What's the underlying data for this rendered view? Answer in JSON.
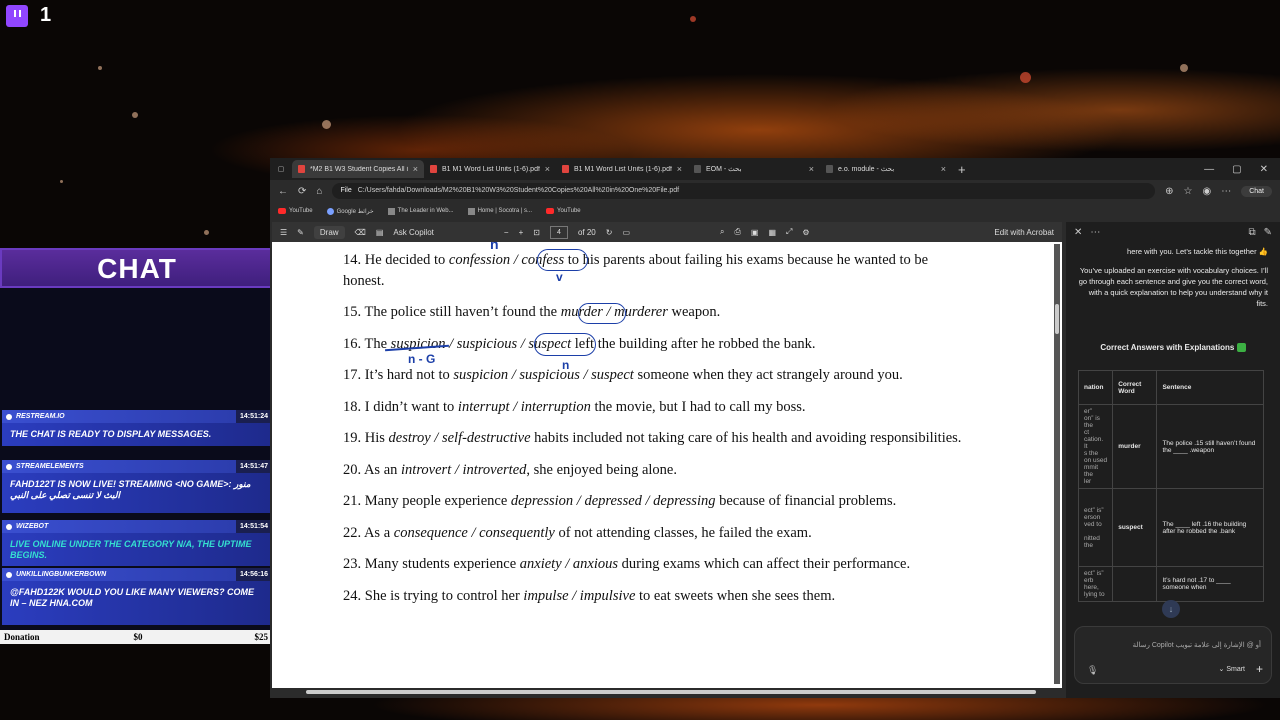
{
  "stream": {
    "viewer_count": "1"
  },
  "chat": {
    "title": "CHAT",
    "messages": [
      {
        "user": "RESTREAM.IO",
        "time": "14:51:24",
        "text": "THE CHAT IS READY TO DISPLAY MESSAGES.",
        "teal": false
      },
      {
        "user": "STREAMELEMENTS",
        "time": "14:51:47",
        "text": "FAHD122T IS NOW LIVE! STREAMING <NO GAME>: منور البث لا تنسى تصلي على النبي",
        "teal": false
      },
      {
        "user": "WIZEBOT",
        "time": "14:51:54",
        "text": "LIVE ONLINE UNDER THE CATEGORY N/A, THE UPTIME BEGINS.",
        "teal": true
      },
      {
        "user": "UNKILLINGBUNKERBOWN",
        "time": "14:56:16",
        "text": "@FAHD122K WOULD YOU LIKE MANY VIEWERS? COME IN – NEZ HNA.COM",
        "teal": false
      }
    ],
    "donation": {
      "label": "Donation",
      "current": "$0",
      "goal": "$25"
    }
  },
  "browser": {
    "tabs": [
      {
        "label": "*M2 B1 W3 Student Copies All in",
        "active": true
      },
      {
        "label": "B1 M1 Word List Units (1-6).pdf",
        "active": false
      },
      {
        "label": "B1 M1 Word List Units (1-6).pdf",
        "active": false
      },
      {
        "label": "EOM - بحث",
        "active": false
      },
      {
        "label": "e.o. module - بحث",
        "active": false
      }
    ],
    "address": {
      "scheme": "File",
      "url": "C:/Users/fahda/Downloads/M2%20B1%20W3%20Student%20Copies%20All%20in%20One%20File.pdf"
    },
    "copilot_chip": "Chat",
    "bookmarks": [
      "YouTube",
      "Google خرائط",
      "The Leader in Web...",
      "Home | Socotra | s...",
      "YouTube"
    ]
  },
  "pdf_toolbar": {
    "draw": "Draw",
    "ask_copilot": "Ask Copilot",
    "page": "4",
    "of_pages": "of 20",
    "edit": "Edit with Acrobat"
  },
  "pdf": {
    "lines": [
      {
        "n": "14.",
        "parts": [
          [
            "He decided to ",
            false
          ],
          [
            "confession / confess",
            true
          ],
          [
            " to his parents about failing his exams because he wanted to be",
            false
          ]
        ]
      },
      {
        "n": "",
        "parts": [
          [
            "honest.",
            false
          ]
        ]
      },
      {
        "n": "15.",
        "parts": [
          [
            "The police still haven’t found the ",
            false
          ],
          [
            "murder / murderer",
            true
          ],
          [
            " weapon.",
            false
          ]
        ]
      },
      {
        "n": "16.",
        "parts": [
          [
            "The ",
            false
          ],
          [
            "suspicion / suspicious / suspect",
            true
          ],
          [
            " left the building after he robbed the bank.",
            false
          ]
        ]
      },
      {
        "n": "17.",
        "parts": [
          [
            "It’s hard not to ",
            false
          ],
          [
            "suspicion / suspicious / suspect",
            true
          ],
          [
            " someone when they act strangely around you.",
            false
          ]
        ]
      },
      {
        "n": "18.",
        "parts": [
          [
            "I didn’t want to ",
            false
          ],
          [
            "interrupt / interruption",
            true
          ],
          [
            " the movie, but I had to call my boss.",
            false
          ]
        ]
      },
      {
        "n": "19.",
        "parts": [
          [
            "His ",
            false
          ],
          [
            "destroy / self-destructive",
            true
          ],
          [
            " habits included not taking care of his health and avoiding responsibilities.",
            false
          ]
        ]
      },
      {
        "n": "20.",
        "parts": [
          [
            "As an ",
            false
          ],
          [
            "introvert / introverted",
            true
          ],
          [
            ", she enjoyed being alone.",
            false
          ]
        ]
      },
      {
        "n": "21.",
        "parts": [
          [
            "Many people experience ",
            false
          ],
          [
            "depression / depressed / depressing",
            true
          ],
          [
            " because of financial problems.",
            false
          ]
        ]
      },
      {
        "n": "22.",
        "parts": [
          [
            "As a ",
            false
          ],
          [
            "consequence / consequently",
            true
          ],
          [
            " of not attending classes, he failed the exam.",
            false
          ]
        ]
      },
      {
        "n": "23.",
        "parts": [
          [
            "Many students experience ",
            false
          ],
          [
            "anxiety / anxious",
            true
          ],
          [
            " during exams which can affect their performance.",
            false
          ]
        ]
      },
      {
        "n": "24.",
        "parts": [
          [
            "She is trying to control her ",
            false
          ],
          [
            "impulse / impulsive",
            true
          ],
          [
            " to eat sweets when she sees them.",
            false
          ]
        ]
      }
    ],
    "annotations": {
      "mark_n": "n",
      "mark_v": "v",
      "mark_ng": "n - G"
    }
  },
  "copilot": {
    "intro_1": "here with you. Let’s tackle this together 👍",
    "intro_2": "You’ve uploaded an exercise with vocabulary choices. I’ll go through each sentence and give you the correct word, with a quick explanation to help you understand why it fits.",
    "heading": "Correct Answers with Explanations",
    "table_headers": [
      "nation",
      "Correct Word",
      "Sentence"
    ],
    "rows": [
      {
        "explanation": "er”\non” is the\nct\ncation. It\ns the\non used\nmmit the\nler",
        "word": "murder",
        "sentence": "The police .15 still haven’t found the ____ .weapon"
      },
      {
        "explanation": "ect” is”\nerson\nved to\n\nnitted the",
        "word": "suspect",
        "sentence": "The ____ left .16 the building after he robbed the .bank"
      },
      {
        "explanation": "ect” is”\nerb here,\nlying to",
        "word": "",
        "sentence": "It’s hard not .17 to ____ someone when"
      }
    ],
    "input_placeholder": "رسالة Copilot أو @ الإشارة إلى علامة تبويب",
    "mode": "Smart"
  }
}
